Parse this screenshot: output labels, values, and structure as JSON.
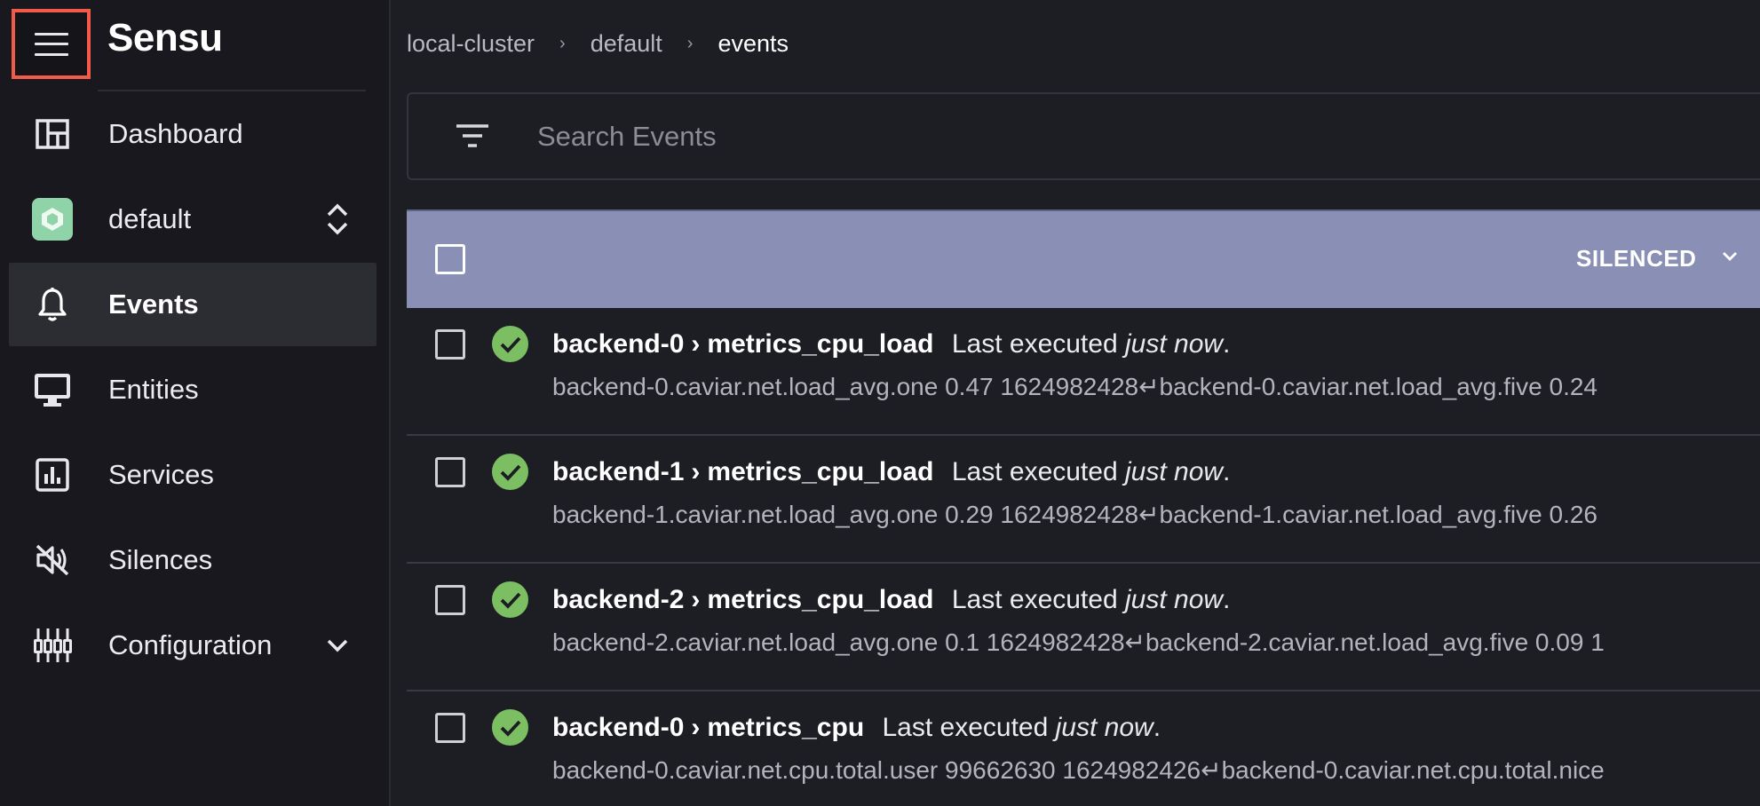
{
  "app": {
    "brand": "Sensu"
  },
  "sidebar": {
    "items": [
      {
        "label": "Dashboard",
        "icon": "dashboard-icon"
      },
      {
        "label": "default",
        "icon": "namespace-badge-icon"
      },
      {
        "label": "Events",
        "icon": "bell-icon",
        "active": true
      },
      {
        "label": "Entities",
        "icon": "monitor-icon"
      },
      {
        "label": "Services",
        "icon": "bar-chart-icon"
      },
      {
        "label": "Silences",
        "icon": "volume-off-icon"
      },
      {
        "label": "Configuration",
        "icon": "sliders-icon"
      }
    ]
  },
  "breadcrumb": [
    "local-cluster",
    "default",
    "events"
  ],
  "search": {
    "placeholder": "Search Events",
    "value": ""
  },
  "table": {
    "header": {
      "silenced_label": "SILENCED"
    },
    "rows": [
      {
        "entity": "backend-0",
        "check": "metrics_cpu_load",
        "exec_prefix": "Last executed",
        "exec_when": "just now",
        "exec_suffix": ".",
        "output": "backend-0.caviar.net.load_avg.one 0.47 1624982428↵backend-0.caviar.net.load_avg.five 0.24"
      },
      {
        "entity": "backend-1",
        "check": "metrics_cpu_load",
        "exec_prefix": "Last executed",
        "exec_when": "just now",
        "exec_suffix": ".",
        "output": "backend-1.caviar.net.load_avg.one 0.29 1624982428↵backend-1.caviar.net.load_avg.five 0.26"
      },
      {
        "entity": "backend-2",
        "check": "metrics_cpu_load",
        "exec_prefix": "Last executed",
        "exec_when": "just now",
        "exec_suffix": ".",
        "output": "backend-2.caviar.net.load_avg.one 0.1 1624982428↵backend-2.caviar.net.load_avg.five 0.09 1"
      },
      {
        "entity": "backend-0",
        "check": "metrics_cpu",
        "exec_prefix": "Last executed",
        "exec_when": "just now",
        "exec_suffix": ".",
        "output": "backend-0.caviar.net.cpu.total.user 99662630 1624982426↵backend-0.caviar.net.cpu.total.nice"
      }
    ]
  },
  "colors": {
    "header_bg": "#8a8fb5",
    "status_ok": "#7cbf63",
    "namespace_badge": "#8fd4a9",
    "menu_highlight": "#f25a4a"
  }
}
